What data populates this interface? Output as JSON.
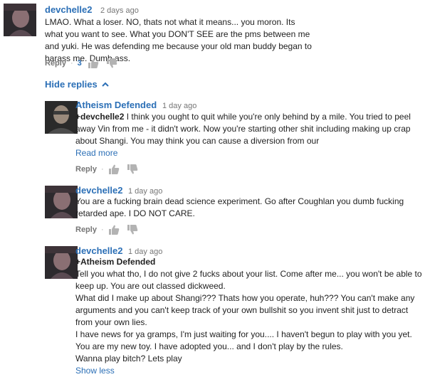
{
  "top_comment": {
    "author": "devchelle2",
    "time": "2 days ago",
    "text": "LMAO. What a loser. NO, thats not what it means... you moron. Its what you want to see.  What you DON'T SEE are the pms between me and yuki. He was defending me because your old man buddy began to harass me.  Dumb ass.",
    "reply_label": "Reply",
    "like_count": "3",
    "avatar_icon": "user-avatar"
  },
  "hide_replies_label": "Hide replies",
  "replies": [
    {
      "author": "Atheism Defended",
      "time": "1 day ago",
      "mention": "+devchelle2",
      "text": " I think you ought to quit while you're only behind by a mile. You tried to peel away Vin from me - it didn't work. Now you're starting other shit including making up crap about Shangi. You may think you can cause a diversion from our",
      "read_more": "Read more",
      "reply_label": "Reply"
    },
    {
      "author": "devchelle2",
      "time": "1 day ago",
      "text": "You are a fucking brain dead science experiment. Go after Coughlan you dumb fucking retarded ape. I DO NOT CARE.",
      "reply_label": "Reply"
    },
    {
      "author": "devchelle2",
      "time": "1 day ago",
      "mention": "+Atheism Defended",
      "paragraphs": [
        "Tell you what tho, I do not give 2 fucks about your list. Come after me... you won't be able to keep up. You are out classed dickweed.",
        "What did I make up about Shangi??? Thats how you operate, huh??? You can't make any arguments and you can't keep track of your own bullshit so you invent shit just to detract from your own lies.",
        "I have news for ya gramps, I'm just waiting for you.... I haven't begun to play with you yet. You are my new toy. I have adopted you... and I don't play by the rules.",
        "Wanna play bitch? Lets play"
      ],
      "show_less": "Show less"
    }
  ],
  "colors": {
    "link_blue": "#2b6fb6",
    "meta_gray": "#767676",
    "text": "#222222"
  }
}
